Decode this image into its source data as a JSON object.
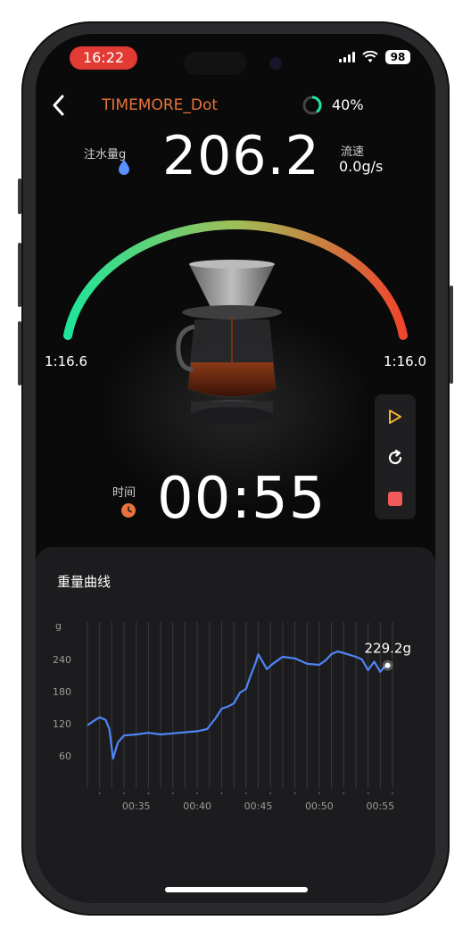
{
  "status_bar": {
    "time": "16:22",
    "battery": "98"
  },
  "header": {
    "device_name": "TIMEMORE_Dot",
    "battery_pct": "40%",
    "battery_level": 0.4
  },
  "water": {
    "label": "注水量g",
    "value": "206.2"
  },
  "flow": {
    "label": "流速",
    "value": "0.0g/s"
  },
  "ratio": {
    "left": "1:16.6",
    "right": "1:16.0"
  },
  "timer": {
    "label": "时间",
    "value": "00:55"
  },
  "controls": [
    {
      "name": "play-icon"
    },
    {
      "name": "reset-icon"
    },
    {
      "name": "stop-icon"
    }
  ],
  "weight_curve": {
    "title": "重量曲线"
  },
  "colors": {
    "accent_orange": "#e8733c",
    "arc_start": "#1fe59a",
    "arc_end": "#f0452c",
    "line": "#4f86f7",
    "stop_red": "#f05a5a",
    "play_yellow": "#f2b233"
  },
  "chart_data": {
    "type": "line",
    "unit_label": "g",
    "yticks": [
      60,
      120,
      180,
      240
    ],
    "ylim": [
      0,
      300
    ],
    "xlim": [
      31,
      56
    ],
    "xticks": [
      "00:35",
      "00:40",
      "00:45",
      "00:50",
      "00:55"
    ],
    "xtick_values": [
      35,
      40,
      45,
      50,
      55
    ],
    "end_label": "229.2g",
    "series": [
      {
        "x": [
          31.0,
          31.5,
          32.0,
          32.5,
          32.8,
          33.1,
          33.5,
          34.0,
          35.0,
          36.0,
          37.0,
          38.0,
          39.0,
          40.0,
          40.8,
          41.5,
          42.0,
          42.5,
          43.0,
          43.5,
          44.0,
          44.3,
          44.8,
          45.0,
          45.3,
          45.7,
          46.2,
          47.0,
          48.0,
          49.0,
          50.0,
          50.5,
          51.0,
          51.5,
          52.0,
          53.0,
          53.5,
          54.0,
          54.5,
          55.0,
          55.3,
          55.6
        ],
        "values": [
          117,
          125,
          132,
          127,
          110,
          55,
          85,
          98,
          100,
          103,
          100,
          102,
          104,
          106,
          110,
          130,
          148,
          152,
          158,
          178,
          185,
          205,
          235,
          250,
          238,
          222,
          232,
          245,
          242,
          232,
          230,
          238,
          250,
          255,
          252,
          245,
          240,
          220,
          236,
          217,
          225,
          229
        ]
      }
    ]
  }
}
